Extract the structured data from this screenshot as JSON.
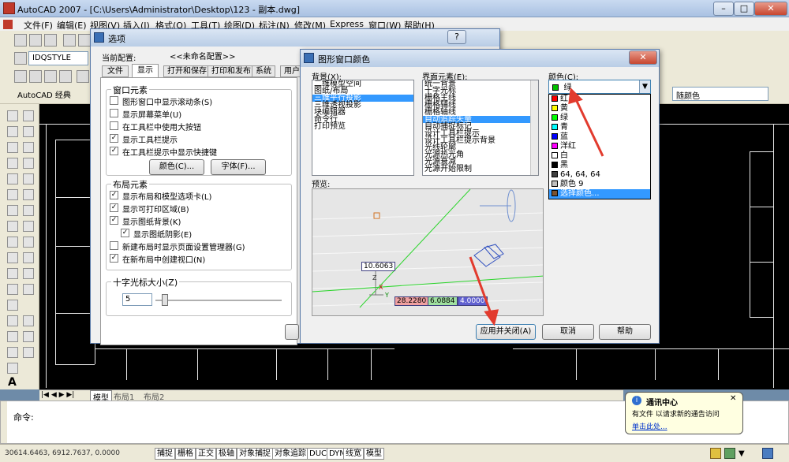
{
  "window": {
    "title": "AutoCAD 2007 - [C:\\Users\\Administrator\\Desktop\\123 - 副本.dwg]",
    "min": "–",
    "max": "□",
    "close": "✕"
  },
  "menu": [
    "文件(F)",
    "编辑(E)",
    "视图(V)",
    "插入(I)",
    "格式(O)",
    "工具(T)",
    "绘图(D)",
    "标注(N)",
    "修改(M)",
    "Express",
    "窗口(W)",
    "帮助(H)"
  ],
  "toolbar": {
    "style_combo": "IDQSTYLE",
    "workspace": "AutoCAD 经典",
    "color_combo": "随颜色"
  },
  "sheet_tabs": [
    "模型",
    "布局1",
    "布局2"
  ],
  "command": {
    "prompt": "命令:"
  },
  "status": {
    "coords": "30614.6463, 6912.7637, 0.0000",
    "buttons": [
      "捕捉",
      "栅格",
      "正交",
      "极轴",
      "对象捕捉",
      "对象追踪",
      "DUCS",
      "DYN",
      "线宽",
      "模型"
    ]
  },
  "balloon": {
    "title": "通讯中心",
    "text": "有文件 以请求新的通告访问",
    "link": "单击此处..."
  },
  "options_dialog": {
    "title": "选项",
    "help": "?",
    "close": "✕",
    "profile_label": "当前配置:",
    "profile_value": "<<未命名配置>>",
    "tabs": [
      "文件",
      "显示",
      "打开和保存",
      "打印和发布",
      "系统",
      "用户"
    ],
    "window_elements": {
      "title": "窗口元素",
      "items": [
        {
          "label": "图形窗口中显示滚动条(S)",
          "checked": false
        },
        {
          "label": "显示屏幕菜单(U)",
          "checked": false
        },
        {
          "label": "在工具栏中使用大按钮",
          "checked": false
        },
        {
          "label": "显示工具栏提示",
          "checked": true
        },
        {
          "label": "在工具栏提示中显示快捷键",
          "checked": true
        }
      ],
      "color_btn": "颜色(C)...",
      "font_btn": "字体(F)..."
    },
    "layout_elements": {
      "title": "布局元素",
      "items": [
        {
          "label": "显示布局和模型选项卡(L)",
          "checked": true
        },
        {
          "label": "显示可打印区域(B)",
          "checked": true
        },
        {
          "label": "显示图纸背景(K)",
          "checked": true
        },
        {
          "label": "显示图纸阴影(E)",
          "checked": true
        },
        {
          "label": "新建布局时显示页面设置管理器(G)",
          "checked": false
        },
        {
          "label": "在新布局中创建视口(N)",
          "checked": true
        }
      ]
    },
    "crosshair": {
      "title": "十字光标大小(Z)",
      "value": "5",
      "level": 0.05
    }
  },
  "color_dialog": {
    "title": "图形窗口颜色",
    "close": "✕",
    "background_label": "背景(X):",
    "background_items": [
      "二维模型空间",
      "图纸/布局",
      "三维平行投影",
      "三维透视投影",
      "块编辑器",
      "命令行",
      "打印预览"
    ],
    "background_selected": 2,
    "elements_label": "界面元素(E):",
    "elements_items": [
      "统一背景",
      "十字光标",
      "栅格主线",
      "栅格辅线",
      "栅格轴线",
      "自动追踪矢量",
      "自动捕捉标记",
      "设计工具栏提示",
      "设计工具栏提示背景",
      "光线轮廓",
      "光源热光角",
      "光源衰减",
      "光源开始限制"
    ],
    "elements_selected": 5,
    "color_label": "颜色(C):",
    "color_value": "绿",
    "color_value_swatch": "#00c000",
    "color_options": [
      {
        "label": "红",
        "color": "#ff0000"
      },
      {
        "label": "黄",
        "color": "#ffff00"
      },
      {
        "label": "绿",
        "color": "#00ff00"
      },
      {
        "label": "青",
        "color": "#00ffff"
      },
      {
        "label": "蓝",
        "color": "#0000ff"
      },
      {
        "label": "洋红",
        "color": "#ff00ff"
      },
      {
        "label": "白",
        "color": "#ffffff"
      },
      {
        "label": "黑",
        "color": "#000000"
      },
      {
        "label": "64, 64, 64",
        "color": "#404040"
      },
      {
        "label": "颜色 9",
        "color": "#c0c0c0"
      },
      {
        "label": "选择颜色...",
        "color": "#7a5230"
      }
    ],
    "color_selected": 10,
    "preview_label": "预览:",
    "preview_values": [
      "10.6063",
      "28.2280",
      "6.0884",
      "4.0000"
    ],
    "preview_axes": [
      "Z",
      "X",
      "Y"
    ],
    "apply_btn": "应用并关闭(A)",
    "cancel_btn": "取消",
    "help_btn": "帮助"
  },
  "colors": {
    "highlight": "#3399ff",
    "arrow": "#e23b2e"
  }
}
